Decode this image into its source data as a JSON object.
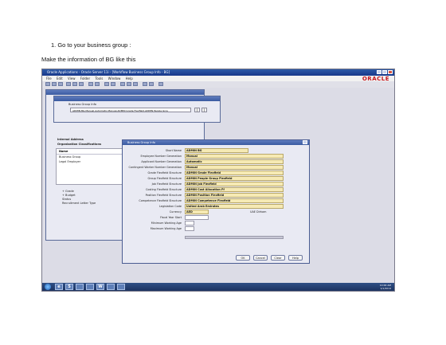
{
  "document": {
    "step": "1.  Go to your business group :",
    "note": "Make the information of BG like this"
  },
  "window": {
    "title": "Oracle Applications - Oracle Server 11i - [Workflow Business Group Info - BG]",
    "menu": [
      "File",
      "Edit",
      "View",
      "Folder",
      "Tools",
      "Window",
      "Help"
    ],
    "logo": "ORACLE"
  },
  "bg_info_window": {
    "title": "Business Group Info",
    "label": "Business Group Info",
    "value": "ADMIN BG.Manual.Automatic.Manual.ADMIN Grade Flexfield.ADMIN People Grou",
    "btn1": "[",
    "btn2": "]"
  },
  "org_window": {
    "internal_address": "Internal Address",
    "org_classifications": "Organization Classifications",
    "list_header": "Name",
    "rows": [
      "Business Group",
      "Legal Employer"
    ],
    "tree": [
      "+ Grade",
      "+ Budget",
      "Status",
      "Recruitment Letter Type"
    ]
  },
  "dialog": {
    "title": "Business Group Info",
    "fields": [
      {
        "label": "Short Name",
        "value": "ADMIN BG"
      },
      {
        "label": "Employee Number Generation",
        "value": "Manual"
      },
      {
        "label": "Applicant Number Generation",
        "value": "Automatic"
      },
      {
        "label": "Contingent Worker Number Generation",
        "value": "Manual"
      },
      {
        "label": "Grade Flexfield Structure",
        "value": "ADMIN Grade Flexfield"
      },
      {
        "label": "Group Flexfield Structure",
        "value": "ADMIN People Group Flexfield"
      },
      {
        "label": "Job Flexfield Structure",
        "value": "ADMIN Job Flexfield"
      },
      {
        "label": "Costing Flexfield Structure",
        "value": "ADMIN Cost Allocation Ff"
      },
      {
        "label": "Position Flexfield Structure",
        "value": "ADMIN Position Flexfield"
      },
      {
        "label": "Competence Flexfield Structure",
        "value": "ADMIN Competence Flexfield"
      },
      {
        "label": "Legislation Code",
        "value": "United Arab Emirates"
      },
      {
        "label": "Currency",
        "value": "AED",
        "extra": "UAE Dirham"
      },
      {
        "label": "Fiscal Year Start",
        "value": ""
      },
      {
        "label": "Minimum Working Age",
        "value": ""
      },
      {
        "label": "Maximum Working Age",
        "value": ""
      }
    ],
    "buttons": {
      "ok": "OK",
      "cancel": "Cancel",
      "clear": "Clear",
      "help": "Help"
    }
  },
  "taskbar": {
    "apps": [
      "e",
      "S",
      "",
      "",
      "W",
      "",
      ""
    ],
    "time": "10:00 AM",
    "date": "1/1/2014"
  },
  "colors": {
    "field_fill": "#f6eab4",
    "title_blue": "#3a5aa0",
    "oracle_red": "#c4161c"
  }
}
